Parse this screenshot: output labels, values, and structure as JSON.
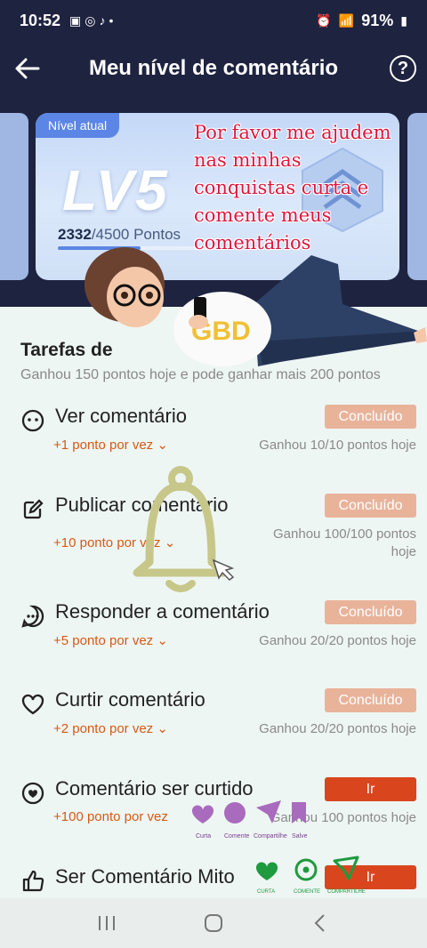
{
  "status_bar": {
    "time": "10:52",
    "battery": "91%"
  },
  "header": {
    "title": "Meu nível de comentário",
    "help_icon": "?"
  },
  "level_card": {
    "badge": "Nível atual",
    "level": "LV5",
    "points_current": "2332",
    "points_rest": "/4500 Pontos",
    "progress": 0.518
  },
  "overlay_text": [
    "Por favor me ajudem",
    "nas minhas",
    "conquistas curta e",
    "comente meus",
    "comentários"
  ],
  "tasks_section": {
    "title": "Tarefas de",
    "subtitle": "Ganhou 150 pontos hoje e pode ganhar mais 200 pontos"
  },
  "tasks": [
    {
      "name": "Ver comentário",
      "points": "+1 ponto por vez",
      "earned": "Ganhou 10/10 pontos hoje",
      "button": "Concluído",
      "status": "done",
      "icon": "comment-icon"
    },
    {
      "name": "Publicar comentário",
      "points": "+10 ponto por vez",
      "earned": "Ganhou 100/100 pontos hoje",
      "button": "Concluído",
      "status": "done",
      "icon": "edit-icon"
    },
    {
      "name": "Responder a comentário",
      "points": "+5 ponto por vez",
      "earned": "Ganhou 20/20 pontos hoje",
      "button": "Concluído",
      "status": "done",
      "icon": "chat-dots-icon"
    },
    {
      "name": "Curtir comentário",
      "points": "+2 ponto por vez",
      "earned": "Ganhou 20/20 pontos hoje",
      "button": "Concluído",
      "status": "done",
      "icon": "heart-icon"
    },
    {
      "name": "Comentário ser curtido",
      "points": "+100 ponto por vez",
      "earned": "Ganhou 100 pontos hoje",
      "button": "Ir",
      "status": "go",
      "icon": "heart-circle-icon"
    },
    {
      "name": "Ser Comentário Mito",
      "points": "",
      "earned": "",
      "button": "Ir",
      "status": "go",
      "icon": "thumbs-up-icon"
    }
  ],
  "sticker_labels": {
    "row1": [
      "Curta",
      "Comente",
      "Compartilhe",
      "Salve"
    ],
    "row2": [
      "CURTA",
      "COMENTE",
      "COMPARTILHE"
    ]
  },
  "colors": {
    "header_bg": "#1e2340",
    "page_bg": "#eef6f4",
    "done_button": "#e9b39a",
    "go_button": "#d9461e",
    "points_text": "#d45a16"
  }
}
